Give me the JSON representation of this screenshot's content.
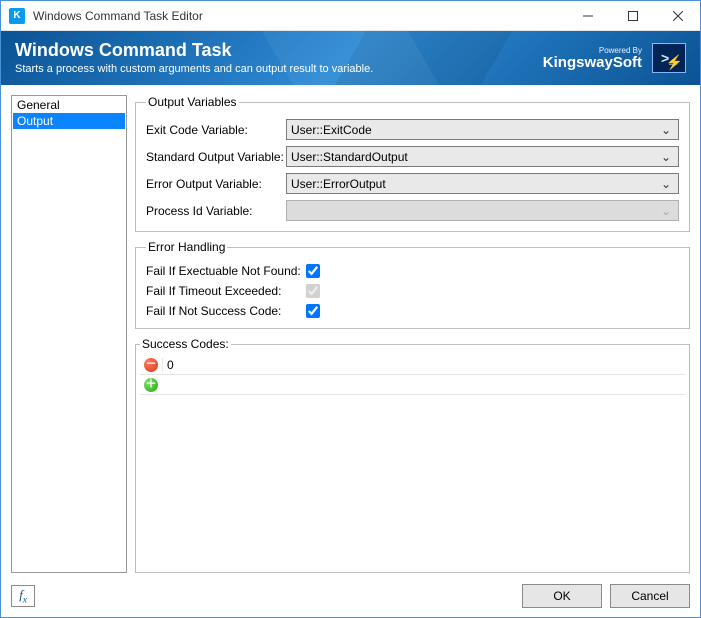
{
  "window": {
    "title": "Windows Command Task Editor"
  },
  "banner": {
    "title": "Windows Command Task",
    "subtitle": "Starts a process with custom arguments and can output result to variable.",
    "poweredBy": "Powered By",
    "brand": "KingswaySoft"
  },
  "nav": {
    "items": [
      {
        "label": "General",
        "selected": false
      },
      {
        "label": "Output",
        "selected": true
      }
    ]
  },
  "outputVars": {
    "legend": "Output Variables",
    "exitCodeLabel": "Exit Code Variable:",
    "exitCodeValue": "User::ExitCode",
    "stdoutLabel": "Standard Output Variable:",
    "stdoutValue": "User::StandardOutput",
    "stderrLabel": "Error Output Variable:",
    "stderrValue": "User::ErrorOutput",
    "pidLabel": "Process Id Variable:",
    "pidValue": ""
  },
  "errorHandling": {
    "legend": "Error Handling",
    "execNotFoundLabel": "Fail If Exectuable Not Found:",
    "execNotFoundChecked": true,
    "timeoutLabel": "Fail If Timeout Exceeded:",
    "timeoutChecked": true,
    "timeoutDisabled": true,
    "notSuccessLabel": "Fail If Not Success Code:",
    "notSuccessChecked": true
  },
  "successCodes": {
    "legend": "Success Codes:",
    "rows": [
      {
        "value": "0"
      }
    ]
  },
  "footer": {
    "ok": "OK",
    "cancel": "Cancel"
  }
}
